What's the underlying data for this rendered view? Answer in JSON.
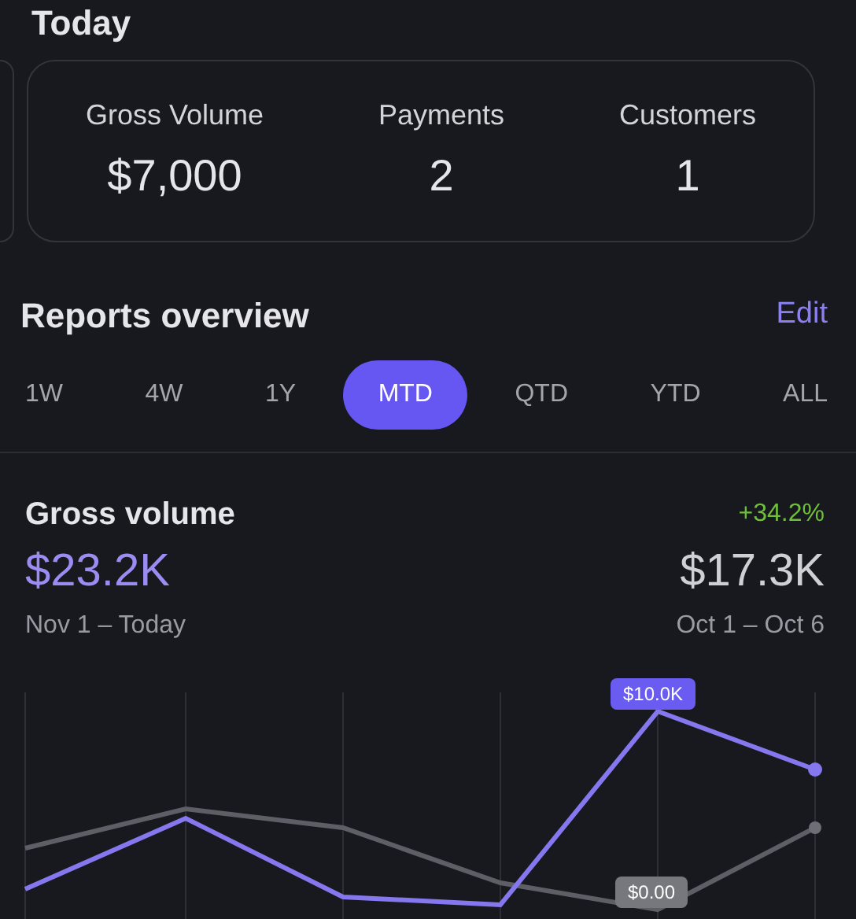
{
  "today": {
    "title": "Today",
    "stats": [
      {
        "label": "Gross Volume",
        "value": "$7,000"
      },
      {
        "label": "Payments",
        "value": "2"
      },
      {
        "label": "Customers",
        "value": "1"
      }
    ]
  },
  "reports": {
    "title": "Reports overview",
    "edit": "Edit",
    "tabs": [
      {
        "label": "1W",
        "selected": false
      },
      {
        "label": "4W",
        "selected": false
      },
      {
        "label": "1Y",
        "selected": false
      },
      {
        "label": "MTD",
        "selected": true
      },
      {
        "label": "QTD",
        "selected": false
      },
      {
        "label": "YTD",
        "selected": false
      },
      {
        "label": "ALL",
        "selected": false
      }
    ]
  },
  "gross_volume": {
    "title": "Gross volume",
    "change": "+34.2%",
    "current": "$23.2K",
    "current_range": "Nov 1 – Today",
    "previous": "$17.3K",
    "previous_range": "Oct 1 – Oct 6",
    "current_marker": "$10.0K",
    "previous_marker": "$0.00"
  }
}
